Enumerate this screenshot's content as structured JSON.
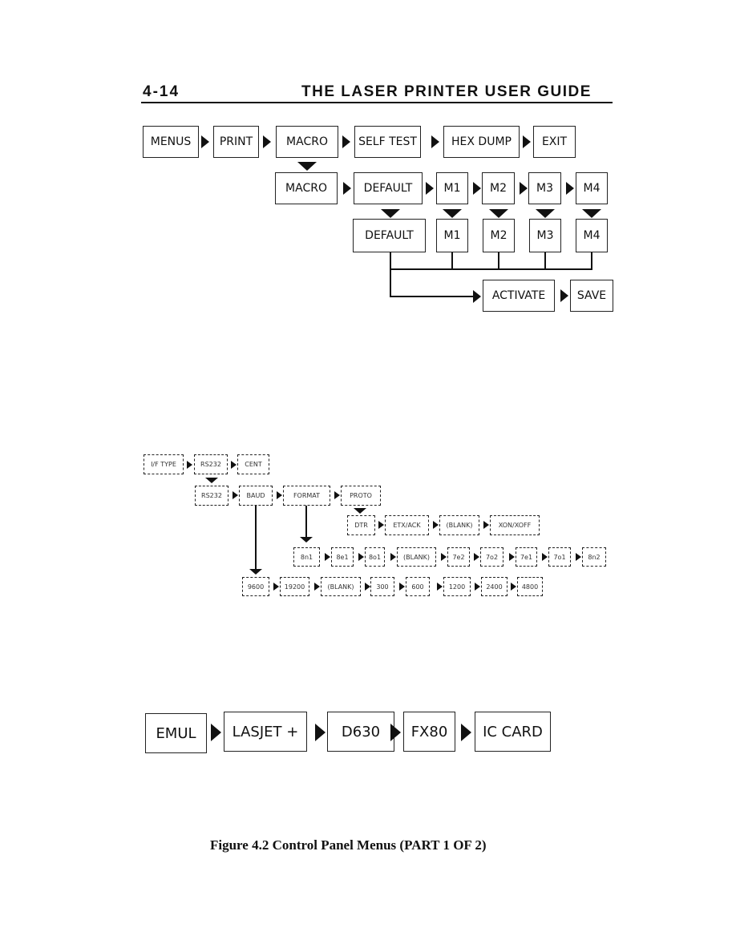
{
  "header": {
    "page_number": "4-14",
    "title": "THE LASER PRINTER USER GUIDE"
  },
  "diagram_menus": {
    "row1": [
      "MENUS",
      "PRINT",
      "MACRO",
      "SELF TEST",
      "HEX DUMP",
      "EXIT"
    ],
    "row2": [
      "MACRO",
      "DEFAULT",
      "M1",
      "M2",
      "M3",
      "M4"
    ],
    "row3": [
      "DEFAULT",
      "M1",
      "M2",
      "M3",
      "M4"
    ],
    "row4": [
      "ACTIVATE",
      "SAVE"
    ]
  },
  "diagram_interface": {
    "row1": [
      "I/F TYPE",
      "RS232",
      "CENT"
    ],
    "row2": [
      "RS232",
      "BAUD",
      "FORMAT",
      "PROTO"
    ],
    "protocol": [
      "DTR",
      "ETX/ACK",
      "(BLANK)",
      "XON/XOFF"
    ],
    "format": [
      "8n1",
      "8e1",
      "8o1",
      "(BLANK)",
      "7e2",
      "7o2",
      "7e1",
      "7o1",
      "8n2"
    ],
    "baud": [
      "9600",
      "19200",
      "(BLANK)",
      "300",
      "600",
      "1200",
      "2400",
      "4800"
    ]
  },
  "diagram_emulation": {
    "row1": [
      "EMUL",
      "LASJET +",
      "D630",
      "FX80",
      "IC CARD"
    ]
  },
  "caption": "Figure 4.2  Control Panel Menus  (PART 1 OF 2)"
}
